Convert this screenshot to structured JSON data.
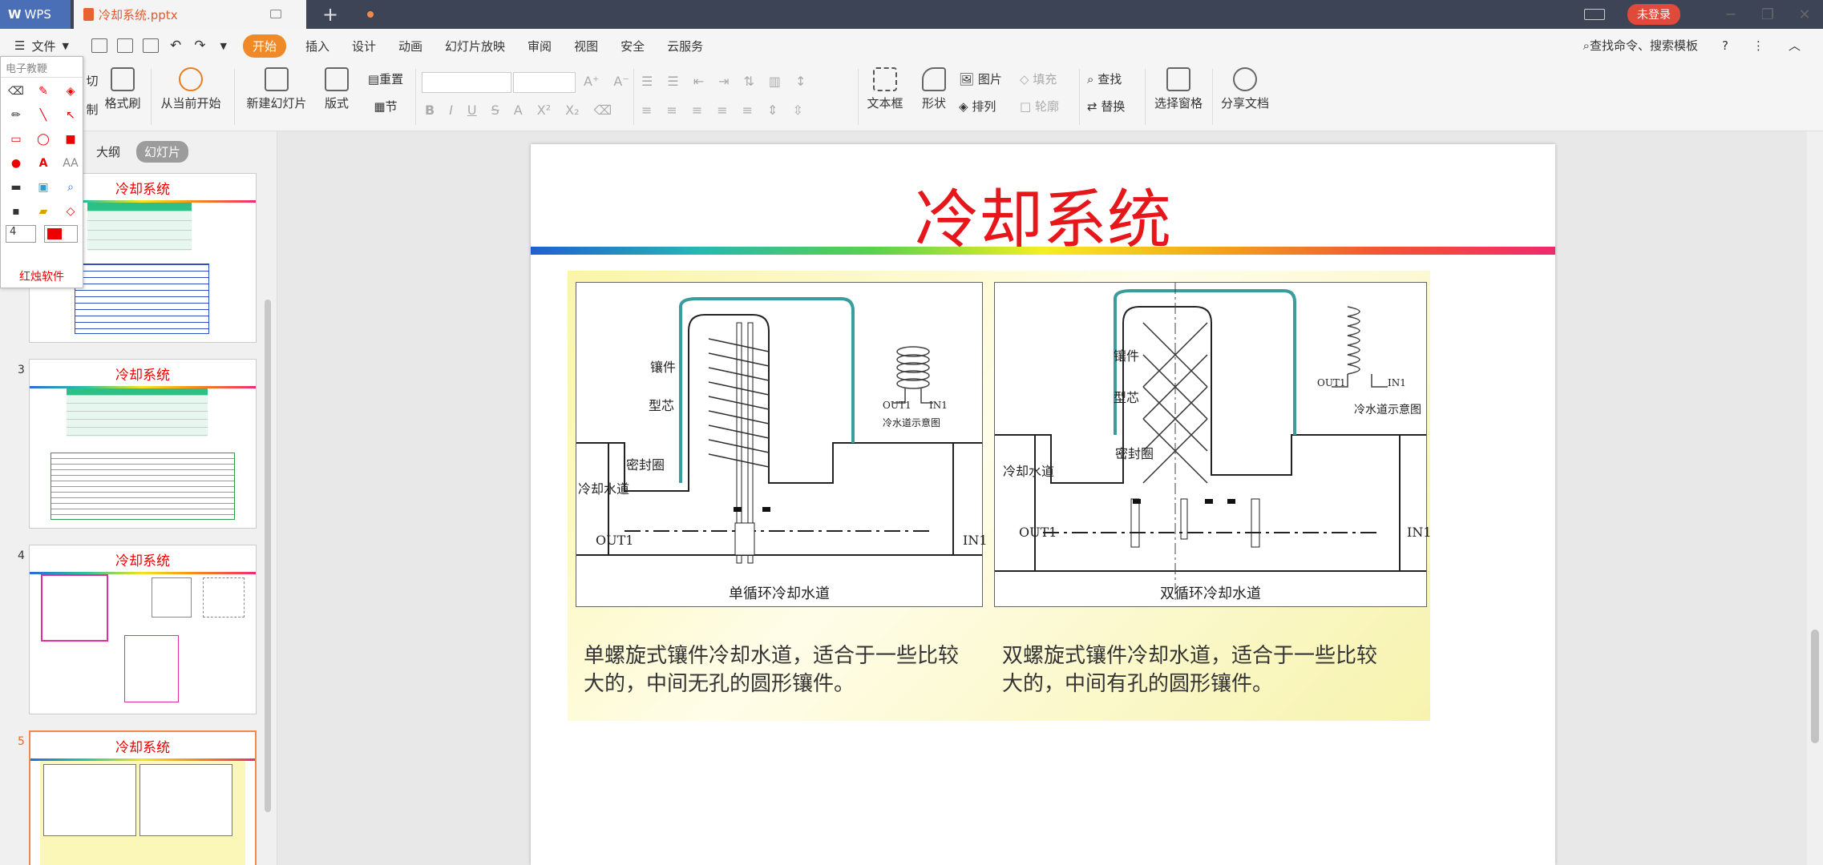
{
  "titlebar": {
    "app_tab": "WPS",
    "doc_tab": "冷却系统.pptx",
    "new_tab_symbol": "+",
    "login_label": "未登录"
  },
  "menubar": {
    "file_label": "文件",
    "active_tab": "开始",
    "items": [
      "插入",
      "设计",
      "动画",
      "幻灯片放映",
      "审阅",
      "视图",
      "安全",
      "云服务"
    ],
    "search_label": "查找命令、搜索模板",
    "help_symbol": "?"
  },
  "ribbon": {
    "cut": "切",
    "copy": "制",
    "format_painter": "格式刷",
    "from_current": "从当前开始",
    "new_slide": "新建幻灯片",
    "layout": "版式",
    "reset": "重置",
    "section": "节",
    "textbox": "文本框",
    "shape": "形状",
    "picture": "图片",
    "fill": "填充",
    "arrange": "排列",
    "outline": "轮廓",
    "find": "查找",
    "replace": "替换",
    "selection_pane": "选择窗格",
    "share_doc": "分享文档"
  },
  "panel": {
    "tab_outline": "大纲",
    "tab_slides": "幻灯片",
    "thumbnails": [
      {
        "num": "",
        "title": "冷却系统"
      },
      {
        "num": "3",
        "title": "冷却系统"
      },
      {
        "num": "4",
        "title": "冷却系统"
      },
      {
        "num": "5",
        "title": "冷却系统"
      }
    ]
  },
  "pen_toolbar": {
    "title": "电子教鞭",
    "size_value": "4",
    "footer": "红烛软件"
  },
  "slide": {
    "title": "冷却系统",
    "left_diagram": {
      "caption": "单循环冷却水道",
      "labels": [
        "镶件",
        "型芯",
        "密封圈",
        "冷却水道",
        "OUT1",
        "IN1",
        "冷水道示意图",
        "OUT1",
        "IN1"
      ]
    },
    "right_diagram": {
      "caption": "双循环冷却水道",
      "labels": [
        "镶件",
        "型芯",
        "密封圈",
        "冷却水道",
        "OUT1",
        "IN1",
        "OUT1",
        "IN1",
        "冷水道示意图"
      ]
    },
    "caption_left": "单螺旋式镶件冷却水道，适合于一些比较大的，中间无孔的圆形镶件。",
    "caption_right": "双螺旋式镶件冷却水道，适合于一些比较大的，中间有孔的圆形镶件。"
  },
  "colors": {
    "titlebar": "#3c4456",
    "accent": "#f08a28",
    "slide_title": "#e6161b"
  }
}
